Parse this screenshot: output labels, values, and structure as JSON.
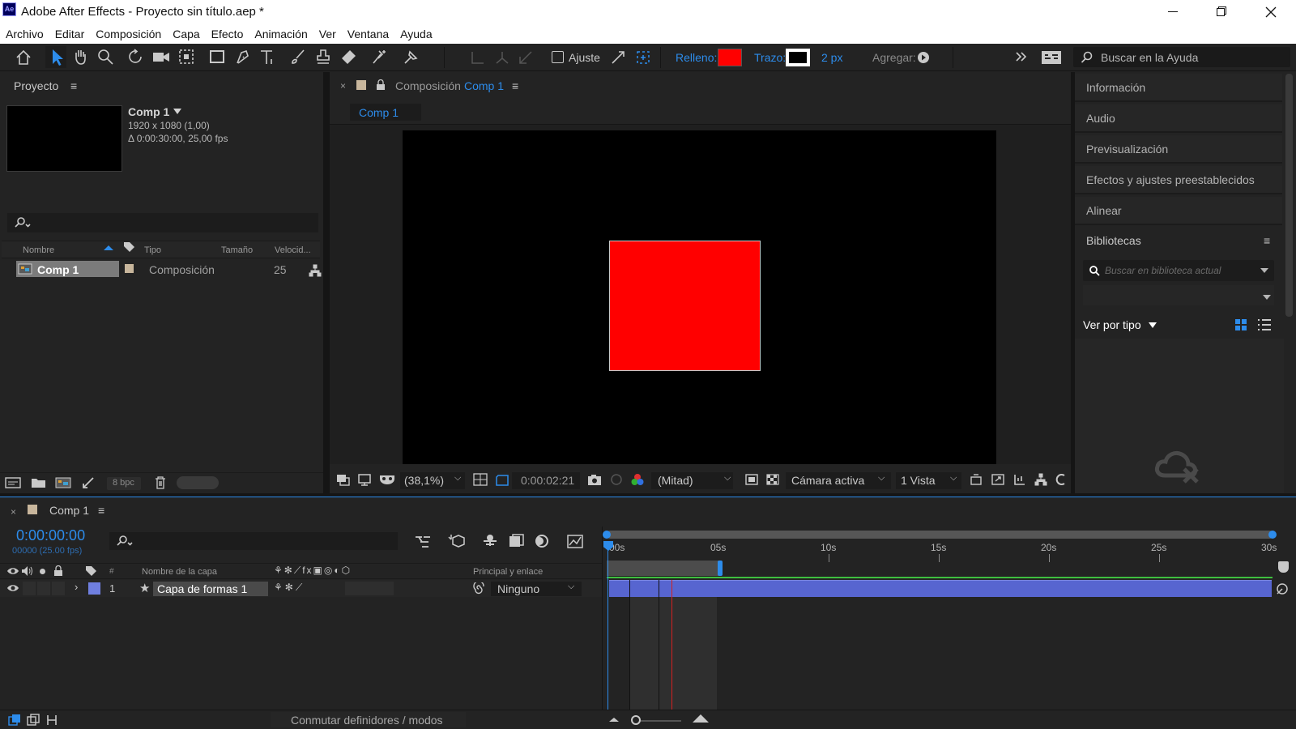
{
  "window": {
    "app_title": "Adobe After Effects - Proyecto sin título.aep *",
    "app_badge": "Ae"
  },
  "menu": [
    "Archivo",
    "Editar",
    "Composición",
    "Capa",
    "Efecto",
    "Animación",
    "Ver",
    "Ventana",
    "Ayuda"
  ],
  "toolbar": {
    "snap_label": "Ajuste",
    "fill_label": "Relleno:",
    "fill_color": "#ff0000",
    "stroke_label": "Trazo:",
    "stroke_width": "2 px",
    "add_label": "Agregar:",
    "help_search_placeholder": "Buscar en la Ayuda"
  },
  "project": {
    "title": "Proyecto",
    "item_name": "Comp 1",
    "item_res": "1920 x 1080 (1,00)",
    "item_dur": "Δ 0:00:30:00, 25,00 fps",
    "columns": [
      "Nombre",
      "Tipo",
      "Tamaño",
      "Velocid..."
    ],
    "rows": [
      {
        "name": "Comp 1",
        "type": "Composición",
        "speed": "25"
      }
    ],
    "bpc": "8 bpc"
  },
  "composition": {
    "panel_prefix": "Composición",
    "panel_comp": "Comp 1",
    "tab": "Comp 1",
    "zoom": "(38,1%)",
    "timecode": "0:00:02:21",
    "resolution": "(Mitad)",
    "camera": "Cámara activa",
    "views": "1 Vista",
    "shape_color": "#ff0000"
  },
  "right_panels": [
    "Información",
    "Audio",
    "Previsualización",
    "Efectos y ajustes preestablecidos",
    "Alinear"
  ],
  "libraries": {
    "title": "Bibliotecas",
    "search_placeholder": "Buscar en biblioteca actual",
    "view_by": "Ver por tipo"
  },
  "timeline": {
    "tab": "Comp 1",
    "timecode": "0:00:00:00",
    "frames": "00000 (25.00 fps)",
    "col_layer_name": "Nombre de la capa",
    "col_parent": "Principal y enlace",
    "ruler": [
      "00s",
      "05s",
      "10s",
      "15s",
      "20s",
      "25s",
      "30s"
    ],
    "layer": {
      "index": "1",
      "name": "Capa de formas 1",
      "parent": "Ninguno"
    },
    "footer_toggle": "Conmutar definidores / modos"
  }
}
